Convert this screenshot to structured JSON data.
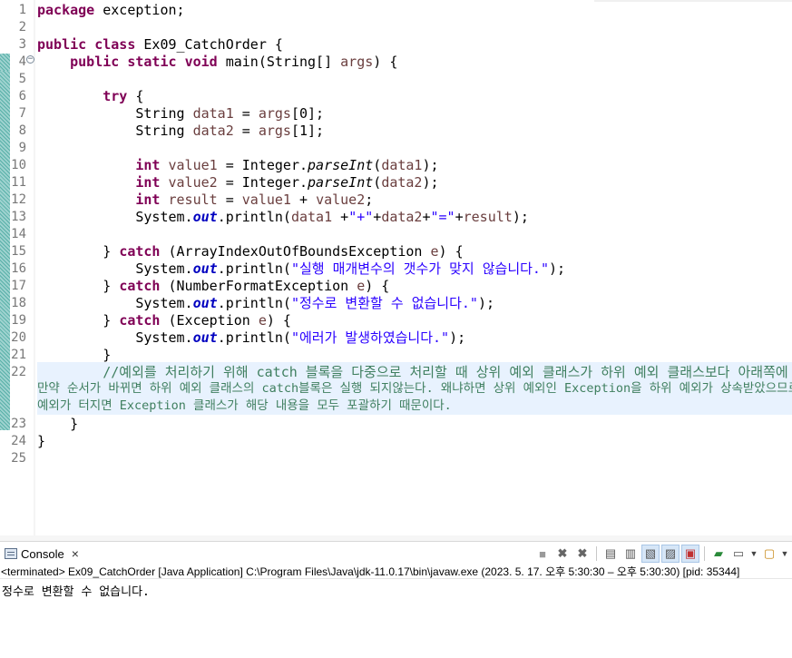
{
  "editor": {
    "lines": [
      {
        "num": "1",
        "segs": [
          {
            "t": "package",
            "c": "k"
          },
          {
            "t": " exception;"
          }
        ]
      },
      {
        "num": "2",
        "segs": []
      },
      {
        "num": "3",
        "segs": [
          {
            "t": "public",
            "c": "k"
          },
          {
            "t": " "
          },
          {
            "t": "class",
            "c": "k"
          },
          {
            "t": " Ex09_CatchOrder {"
          }
        ]
      },
      {
        "num": "4",
        "fold": true,
        "segs": [
          {
            "t": "    "
          },
          {
            "t": "public",
            "c": "k"
          },
          {
            "t": " "
          },
          {
            "t": "static",
            "c": "k"
          },
          {
            "t": " "
          },
          {
            "t": "void",
            "c": "k"
          },
          {
            "t": " main(String[] "
          },
          {
            "t": "args",
            "c": "v"
          },
          {
            "t": ") {"
          }
        ]
      },
      {
        "num": "5",
        "segs": []
      },
      {
        "num": "6",
        "segs": [
          {
            "t": "        "
          },
          {
            "t": "try",
            "c": "k"
          },
          {
            "t": " {"
          }
        ]
      },
      {
        "num": "7",
        "segs": [
          {
            "t": "            String "
          },
          {
            "t": "data1",
            "c": "v"
          },
          {
            "t": " = "
          },
          {
            "t": "args",
            "c": "v"
          },
          {
            "t": "[0];"
          }
        ]
      },
      {
        "num": "8",
        "segs": [
          {
            "t": "            String "
          },
          {
            "t": "data2",
            "c": "v"
          },
          {
            "t": " = "
          },
          {
            "t": "args",
            "c": "v"
          },
          {
            "t": "[1];"
          }
        ]
      },
      {
        "num": "9",
        "segs": []
      },
      {
        "num": "10",
        "segs": [
          {
            "t": "            "
          },
          {
            "t": "int",
            "c": "k"
          },
          {
            "t": " "
          },
          {
            "t": "value1",
            "c": "v"
          },
          {
            "t": " = Integer."
          },
          {
            "t": "parseInt",
            "c": "it"
          },
          {
            "t": "("
          },
          {
            "t": "data1",
            "c": "v"
          },
          {
            "t": ");"
          }
        ]
      },
      {
        "num": "11",
        "segs": [
          {
            "t": "            "
          },
          {
            "t": "int",
            "c": "k"
          },
          {
            "t": " "
          },
          {
            "t": "value2",
            "c": "v"
          },
          {
            "t": " = Integer."
          },
          {
            "t": "parseInt",
            "c": "it"
          },
          {
            "t": "("
          },
          {
            "t": "data2",
            "c": "v"
          },
          {
            "t": ");"
          }
        ]
      },
      {
        "num": "12",
        "segs": [
          {
            "t": "            "
          },
          {
            "t": "int",
            "c": "k"
          },
          {
            "t": " "
          },
          {
            "t": "result",
            "c": "v"
          },
          {
            "t": " = "
          },
          {
            "t": "value1",
            "c": "v"
          },
          {
            "t": " + "
          },
          {
            "t": "value2",
            "c": "v"
          },
          {
            "t": ";"
          }
        ]
      },
      {
        "num": "13",
        "segs": [
          {
            "t": "            System."
          },
          {
            "t": "out",
            "c": "f"
          },
          {
            "t": ".println("
          },
          {
            "t": "data1",
            "c": "v"
          },
          {
            "t": " +"
          },
          {
            "t": "\"+\"",
            "c": "s"
          },
          {
            "t": "+"
          },
          {
            "t": "data2",
            "c": "v"
          },
          {
            "t": "+"
          },
          {
            "t": "\"=\"",
            "c": "s"
          },
          {
            "t": "+"
          },
          {
            "t": "result",
            "c": "v"
          },
          {
            "t": ");"
          }
        ]
      },
      {
        "num": "14",
        "segs": []
      },
      {
        "num": "15",
        "segs": [
          {
            "t": "        } "
          },
          {
            "t": "catch",
            "c": "k"
          },
          {
            "t": " (ArrayIndexOutOfBoundsException "
          },
          {
            "t": "e",
            "c": "v"
          },
          {
            "t": ") {"
          }
        ]
      },
      {
        "num": "16",
        "segs": [
          {
            "t": "            System."
          },
          {
            "t": "out",
            "c": "f"
          },
          {
            "t": ".println("
          },
          {
            "t": "\"실행 매개변수의 갯수가 맞지 않습니다.\"",
            "c": "s"
          },
          {
            "t": ");"
          }
        ]
      },
      {
        "num": "17",
        "segs": [
          {
            "t": "        } "
          },
          {
            "t": "catch",
            "c": "k"
          },
          {
            "t": " (NumberFormatException "
          },
          {
            "t": "e",
            "c": "v"
          },
          {
            "t": ") {"
          }
        ]
      },
      {
        "num": "18",
        "segs": [
          {
            "t": "            System."
          },
          {
            "t": "out",
            "c": "f"
          },
          {
            "t": ".println("
          },
          {
            "t": "\"정수로 변환할 수 없습니다.\"",
            "c": "s"
          },
          {
            "t": ");"
          }
        ]
      },
      {
        "num": "19",
        "segs": [
          {
            "t": "        } "
          },
          {
            "t": "catch",
            "c": "k"
          },
          {
            "t": " (Exception "
          },
          {
            "t": "e",
            "c": "v"
          },
          {
            "t": ") {"
          }
        ]
      },
      {
        "num": "20",
        "segs": [
          {
            "t": "            System."
          },
          {
            "t": "out",
            "c": "f"
          },
          {
            "t": ".println("
          },
          {
            "t": "\"에러가 발생하였습니다.\"",
            "c": "s"
          },
          {
            "t": ");"
          }
        ]
      },
      {
        "num": "21",
        "segs": [
          {
            "t": "        }"
          }
        ]
      },
      {
        "num": "22",
        "segs": [
          {
            "t": "        //예외를 처리하기 위해 catch 블록을 다중으로 처리할 때 상위 예외 클래스가 하위 예외 클래스보다 아래쪽에 위치해야 한다.",
            "c": "c"
          }
        ]
      },
      {
        "num": "23",
        "segs": [
          {
            "t": "    }"
          }
        ]
      },
      {
        "num": "24",
        "segs": [
          {
            "t": "}"
          }
        ]
      },
      {
        "num": "25",
        "segs": []
      }
    ],
    "comment_wrap": [
      "만약 순서가 바뀌면 하위 예외 클래스의 catch블록은 실행 되지않는다. 왜냐하면 상위 예외인 Exception을 하위 예외가 상속받았으므로",
      "예외가 터지면 Exception 클래스가 해당 내용을 모두 포괄하기 때문이다."
    ]
  },
  "console": {
    "tab_label": "Console",
    "status_line": "<terminated> Ex09_CatchOrder [Java Application] C:\\Program Files\\Java\\jdk-11.0.17\\bin\\javaw.exe  (2023. 5. 17. 오후 5:30:30 – 오후 5:30:30) [pid: 35344]",
    "output": "정수로 변환할 수 없습니다."
  },
  "icons": {
    "terminate": "stop-square-icon",
    "remove_launch": "remove-launch-icon",
    "remove_all": "remove-all-terminated-icon",
    "clear": "clear-console-icon",
    "scroll_lock": "scroll-lock-icon",
    "word_wrap": "word-wrap-icon",
    "show_stdout": "show-on-stdout-icon",
    "show_stderr": "show-on-stderr-icon",
    "pin": "pin-console-icon",
    "display_selected": "display-selected-console-icon",
    "open_console": "open-console-icon"
  },
  "colors": {
    "keyword": "#7f0055",
    "string": "#2a00ff",
    "comment": "#3f7f5f",
    "local_var": "#6a3e3e",
    "static_field": "#0000c0",
    "line_number": "#787878",
    "highlight": "#e8f2fe"
  }
}
